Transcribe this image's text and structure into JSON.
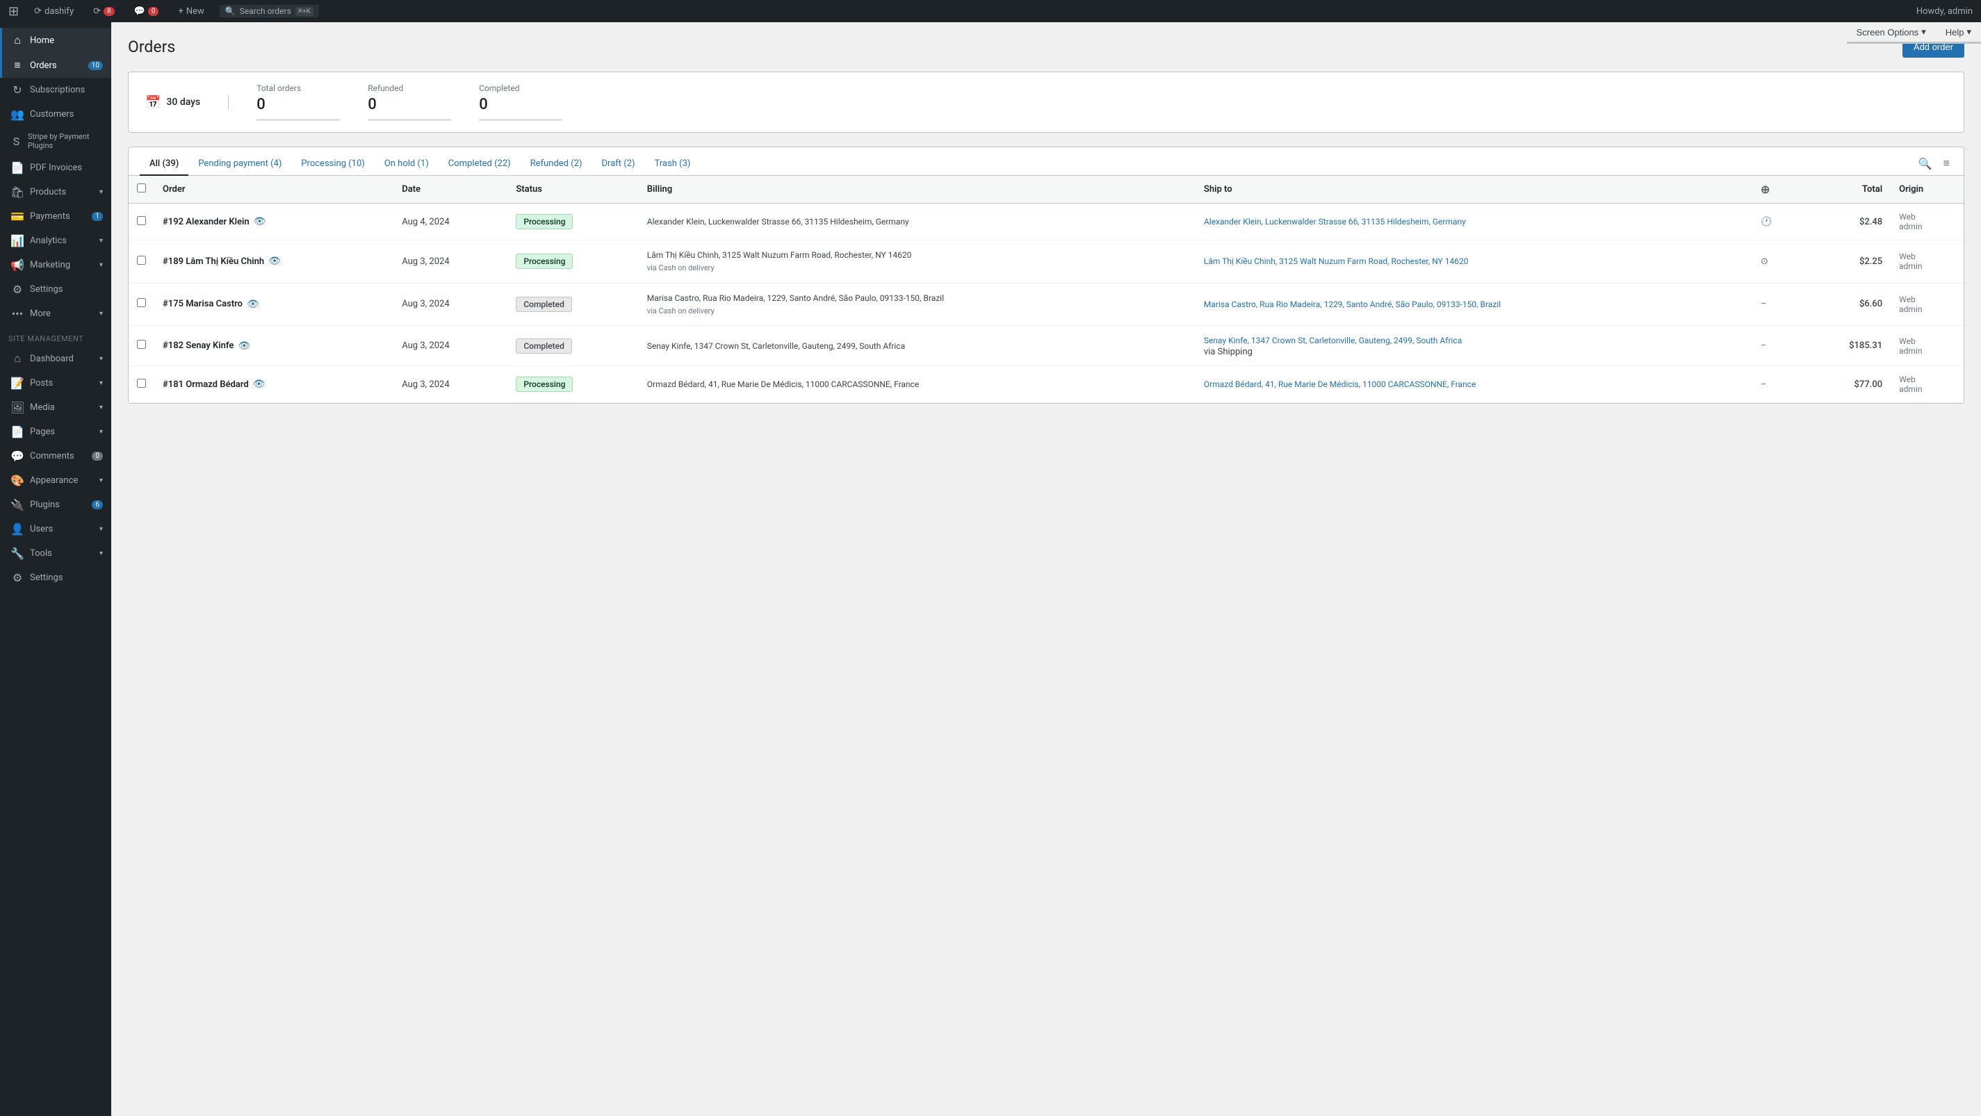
{
  "adminbar": {
    "logo": "⟳",
    "site_name": "dashify",
    "updates_count": "8",
    "comments_count": "0",
    "new_label": "New",
    "search_placeholder": "Search orders",
    "search_shortcut": "⌘+K",
    "howdy": "Howdy, admin"
  },
  "top_buttons": {
    "screen_options": "Screen Options",
    "help": "Help"
  },
  "sidebar": {
    "items": [
      {
        "id": "home",
        "label": "Home",
        "icon": "⌂",
        "active": false
      },
      {
        "id": "orders",
        "label": "Orders",
        "icon": "≡",
        "badge": "10",
        "active": true
      },
      {
        "id": "subscriptions",
        "label": "Subscriptions",
        "icon": "↻",
        "active": false
      },
      {
        "id": "customers",
        "label": "Customers",
        "icon": "👥",
        "active": false
      },
      {
        "id": "stripe",
        "label": "Stripe by Payment Plugins",
        "icon": "S",
        "active": false
      },
      {
        "id": "pdf-invoices",
        "label": "PDF Invoices",
        "icon": "📄",
        "active": false
      },
      {
        "id": "products",
        "label": "Products",
        "icon": "🛍",
        "arrow": "▾",
        "active": false
      },
      {
        "id": "payments",
        "label": "Payments",
        "icon": "💳",
        "badge": "1",
        "active": false
      },
      {
        "id": "analytics",
        "label": "Analytics",
        "icon": "📊",
        "arrow": "▾",
        "active": false
      },
      {
        "id": "marketing",
        "label": "Marketing",
        "icon": "📢",
        "arrow": "▾",
        "active": false
      },
      {
        "id": "settings",
        "label": "Settings",
        "icon": "⚙",
        "active": false
      },
      {
        "id": "more",
        "label": "More",
        "icon": "•••",
        "arrow": "▾",
        "active": false
      }
    ],
    "site_management_label": "Site management",
    "management_items": [
      {
        "id": "dashboard",
        "label": "Dashboard",
        "icon": "⌂",
        "arrow": "▾"
      },
      {
        "id": "posts",
        "label": "Posts",
        "icon": "📝",
        "arrow": "▾"
      },
      {
        "id": "media",
        "label": "Media",
        "icon": "🖼",
        "arrow": "▾"
      },
      {
        "id": "pages",
        "label": "Pages",
        "icon": "📄",
        "arrow": "▾"
      },
      {
        "id": "comments",
        "label": "Comments",
        "icon": "💬",
        "badge": "0"
      },
      {
        "id": "appearance",
        "label": "Appearance",
        "icon": "🎨",
        "arrow": "▾"
      },
      {
        "id": "plugins",
        "label": "Plugins",
        "icon": "🔌",
        "badge": "6",
        "arrow": "▾"
      },
      {
        "id": "users",
        "label": "Users",
        "icon": "👤",
        "arrow": "▾"
      },
      {
        "id": "tools",
        "label": "Tools",
        "icon": "🔧",
        "arrow": "▾"
      },
      {
        "id": "settings2",
        "label": "Settings",
        "icon": "⚙"
      }
    ]
  },
  "page": {
    "title": "Orders",
    "add_order_label": "Add order"
  },
  "stats": {
    "date_range": "30 days",
    "total_orders_label": "Total orders",
    "total_orders_value": "0",
    "refunded_label": "Refunded",
    "refunded_value": "0",
    "completed_label": "Completed",
    "completed_value": "0"
  },
  "filter_tabs": [
    {
      "id": "all",
      "label": "All",
      "count": "(39)",
      "active": true
    },
    {
      "id": "pending",
      "label": "Pending payment",
      "count": "(4)",
      "active": false
    },
    {
      "id": "processing",
      "label": "Processing",
      "count": "(10)",
      "active": false
    },
    {
      "id": "onhold",
      "label": "On hold",
      "count": "(1)",
      "active": false
    },
    {
      "id": "completed",
      "label": "Completed",
      "count": "(22)",
      "active": false
    },
    {
      "id": "refunded",
      "label": "Refunded",
      "count": "(2)",
      "active": false
    },
    {
      "id": "draft",
      "label": "Draft",
      "count": "(2)",
      "active": false
    },
    {
      "id": "trash",
      "label": "Trash",
      "count": "(3)",
      "active": false
    }
  ],
  "table": {
    "columns": [
      "Order",
      "Date",
      "Status",
      "Billing",
      "Ship to",
      "",
      "Total",
      "Origin"
    ],
    "rows": [
      {
        "id": "192",
        "name": "Alexander Klein",
        "date": "Aug 4, 2024",
        "status": "Processing",
        "status_type": "processing",
        "billing": "Alexander Klein, Luckenwalder Strasse 66, 31135 Hildesheim, Germany",
        "billing_via": "",
        "ship_to": "Alexander Klein, Luckenwalder Strasse 66, 31135 Hildesheim, Germany",
        "ship_icon": "clock",
        "total": "$2.48",
        "origin": "Web",
        "origin2": "admin"
      },
      {
        "id": "189",
        "name": "Lâm Thị Kiều Chinh",
        "date": "Aug 3, 2024",
        "status": "Processing",
        "status_type": "processing",
        "billing": "Lâm Thị Kiều Chinh, 3125 Walt Nuzum Farm Road, Rochester, NY 14620",
        "billing_via": "via Cash on delivery",
        "ship_to": "Lâm Thị Kiều Chinh, 3125 Walt Nuzum Farm Road, Rochester, NY 14620",
        "ship_icon": "circle",
        "total": "$2.25",
        "origin": "Web",
        "origin2": "admin"
      },
      {
        "id": "175",
        "name": "Marisa Castro",
        "date": "Aug 3, 2024",
        "status": "Completed",
        "status_type": "completed",
        "billing": "Marisa Castro, Rua Rio Madeira, 1229, Santo André, São Paulo, 09133-150, Brazil",
        "billing_via": "via Cash on delivery",
        "ship_to": "Marisa Castro, Rua Rio Madeira, 1229, Santo André, São Paulo, 09133-150, Brazil",
        "ship_icon": "dash",
        "total": "$6.60",
        "origin": "Web",
        "origin2": "admin"
      },
      {
        "id": "182",
        "name": "Senay Kinfe",
        "date": "Aug 3, 2024",
        "status": "Completed",
        "status_type": "completed",
        "billing": "Senay Kinfe, 1347 Crown St, Carletonville, Gauteng, 2499, South Africa",
        "billing_via": "",
        "ship_to": "Senay Kinfe, 1347 Crown St, Carletonville, Gauteng, 2499, South Africa",
        "ship_via": "via Shipping",
        "ship_icon": "dash",
        "total": "$185.31",
        "origin": "Web",
        "origin2": "admin"
      },
      {
        "id": "181",
        "name": "Ormazd Bédard",
        "date": "Aug 3, 2024",
        "status": "Processing",
        "status_type": "processing",
        "billing": "Ormazd Bédard, 41, Rue Marie De Médicis, 11000 CARCASSONNE, France",
        "billing_via": "",
        "ship_to": "Ormazd Bédard, 41, Rue Marie De Médicis, 11000 CARCASSONNE, France",
        "ship_icon": "dash",
        "total": "$77.00",
        "origin": "Web",
        "origin2": "admin"
      }
    ]
  }
}
